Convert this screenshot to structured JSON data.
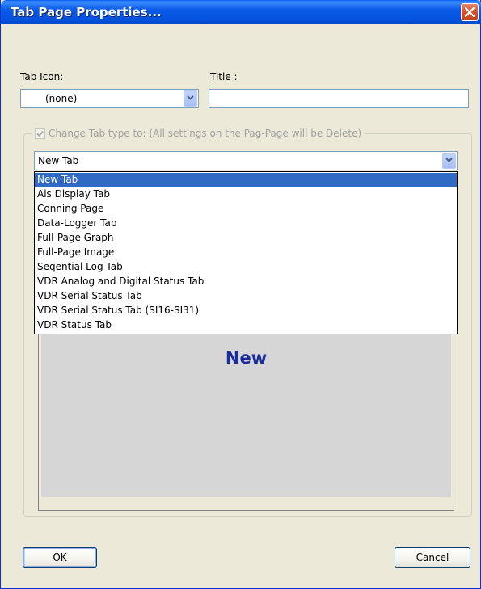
{
  "window": {
    "title": "Tab Page Properties..."
  },
  "tab_icon": {
    "label": "Tab Icon:",
    "value": "(none)"
  },
  "title_field": {
    "label": "Title :",
    "value": ""
  },
  "change_type": {
    "checked": true,
    "label": "Change Tab type to: (All settings on the Pag-Page will be Delete)"
  },
  "tab_type": {
    "value": "New Tab",
    "options": [
      "New Tab",
      "Ais Display Tab",
      "Conning Page",
      "Data-Logger Tab",
      "Full-Page Graph",
      "Full-Page Image",
      "Seqential Log Tab",
      "VDR Analog and Digital Status Tab",
      "VDR Serial Status Tab",
      "VDR Serial Status Tab (SI16-SI31)",
      "VDR Status Tab"
    ],
    "selected_index": 0
  },
  "preview": {
    "text": "New"
  },
  "buttons": {
    "ok": "OK",
    "cancel": "Cancel"
  },
  "colors": {
    "titlebar": "#0a5ae8",
    "selection": "#316ac5",
    "preview_text": "#1a2d9c"
  }
}
